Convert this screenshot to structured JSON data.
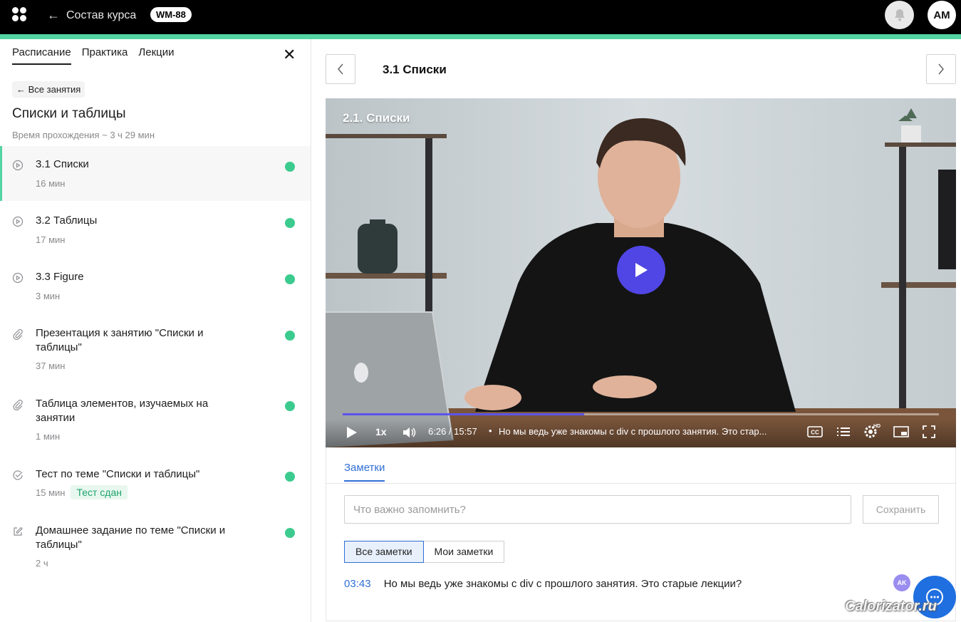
{
  "header": {
    "back_label": "Состав курса",
    "course_code": "WM-88",
    "user_initials": "AM"
  },
  "sidebar": {
    "tabs": [
      {
        "label": "Расписание",
        "active": true
      },
      {
        "label": "Практика",
        "active": false
      },
      {
        "label": "Лекции",
        "active": false
      }
    ],
    "all_lessons_label": "Все занятия",
    "section_title": "Списки и таблицы",
    "total_duration": "Время прохождения ~ 3 ч 29 мин",
    "lessons": [
      {
        "title": "3.1 Списки",
        "duration": "16 мин",
        "icon": "play-circle-icon",
        "done": true,
        "active": true
      },
      {
        "title": "3.2 Таблицы",
        "duration": "17 мин",
        "icon": "play-circle-icon",
        "done": true
      },
      {
        "title": "3.3 Figure",
        "duration": "3 мин",
        "icon": "play-circle-icon",
        "done": true
      },
      {
        "title": "Презентация к занятию \"Списки и таблицы\"",
        "duration": "37 мин",
        "icon": "paperclip-icon",
        "done": true
      },
      {
        "title": "Таблица элементов, изучаемых на занятии",
        "duration": "1 мин",
        "icon": "paperclip-icon",
        "done": true
      },
      {
        "title": "Тест по теме \"Списки и таблицы\"",
        "duration": "15 мин",
        "icon": "check-circle-icon",
        "done": true,
        "status": "Тест сдан"
      },
      {
        "title": "Домашнее задание по теме \"Списки и таблицы\"",
        "duration": "2 ч",
        "icon": "edit-icon",
        "done": true
      }
    ]
  },
  "main": {
    "lesson_title": "3.1 Списки",
    "video": {
      "title": "2.1. Списки",
      "speed": "1x",
      "time": "6:26 / 15:57",
      "caption": "Но мы ведь уже знакомы с div с прошлого занятия. Это стар...",
      "progress": 0.405
    },
    "notes": {
      "tab_label": "Заметки",
      "input_placeholder": "Что важно запомнить?",
      "save_label": "Сохранить",
      "filters": [
        {
          "label": "Все заметки",
          "active": true
        },
        {
          "label": "Мои заметки",
          "active": false
        }
      ],
      "items": [
        {
          "time": "03:43",
          "text": "Но мы ведь уже знакомы с div с прошлого занятия. Это старые лекции?",
          "author_initials": "AK"
        }
      ]
    }
  },
  "watermark": "Calorizator.ru",
  "colors": {
    "accent_green": "#53d4a3",
    "done_dot": "#3ccb8e",
    "link_blue": "#2f6fd6",
    "play_purple": "#5046e5"
  }
}
